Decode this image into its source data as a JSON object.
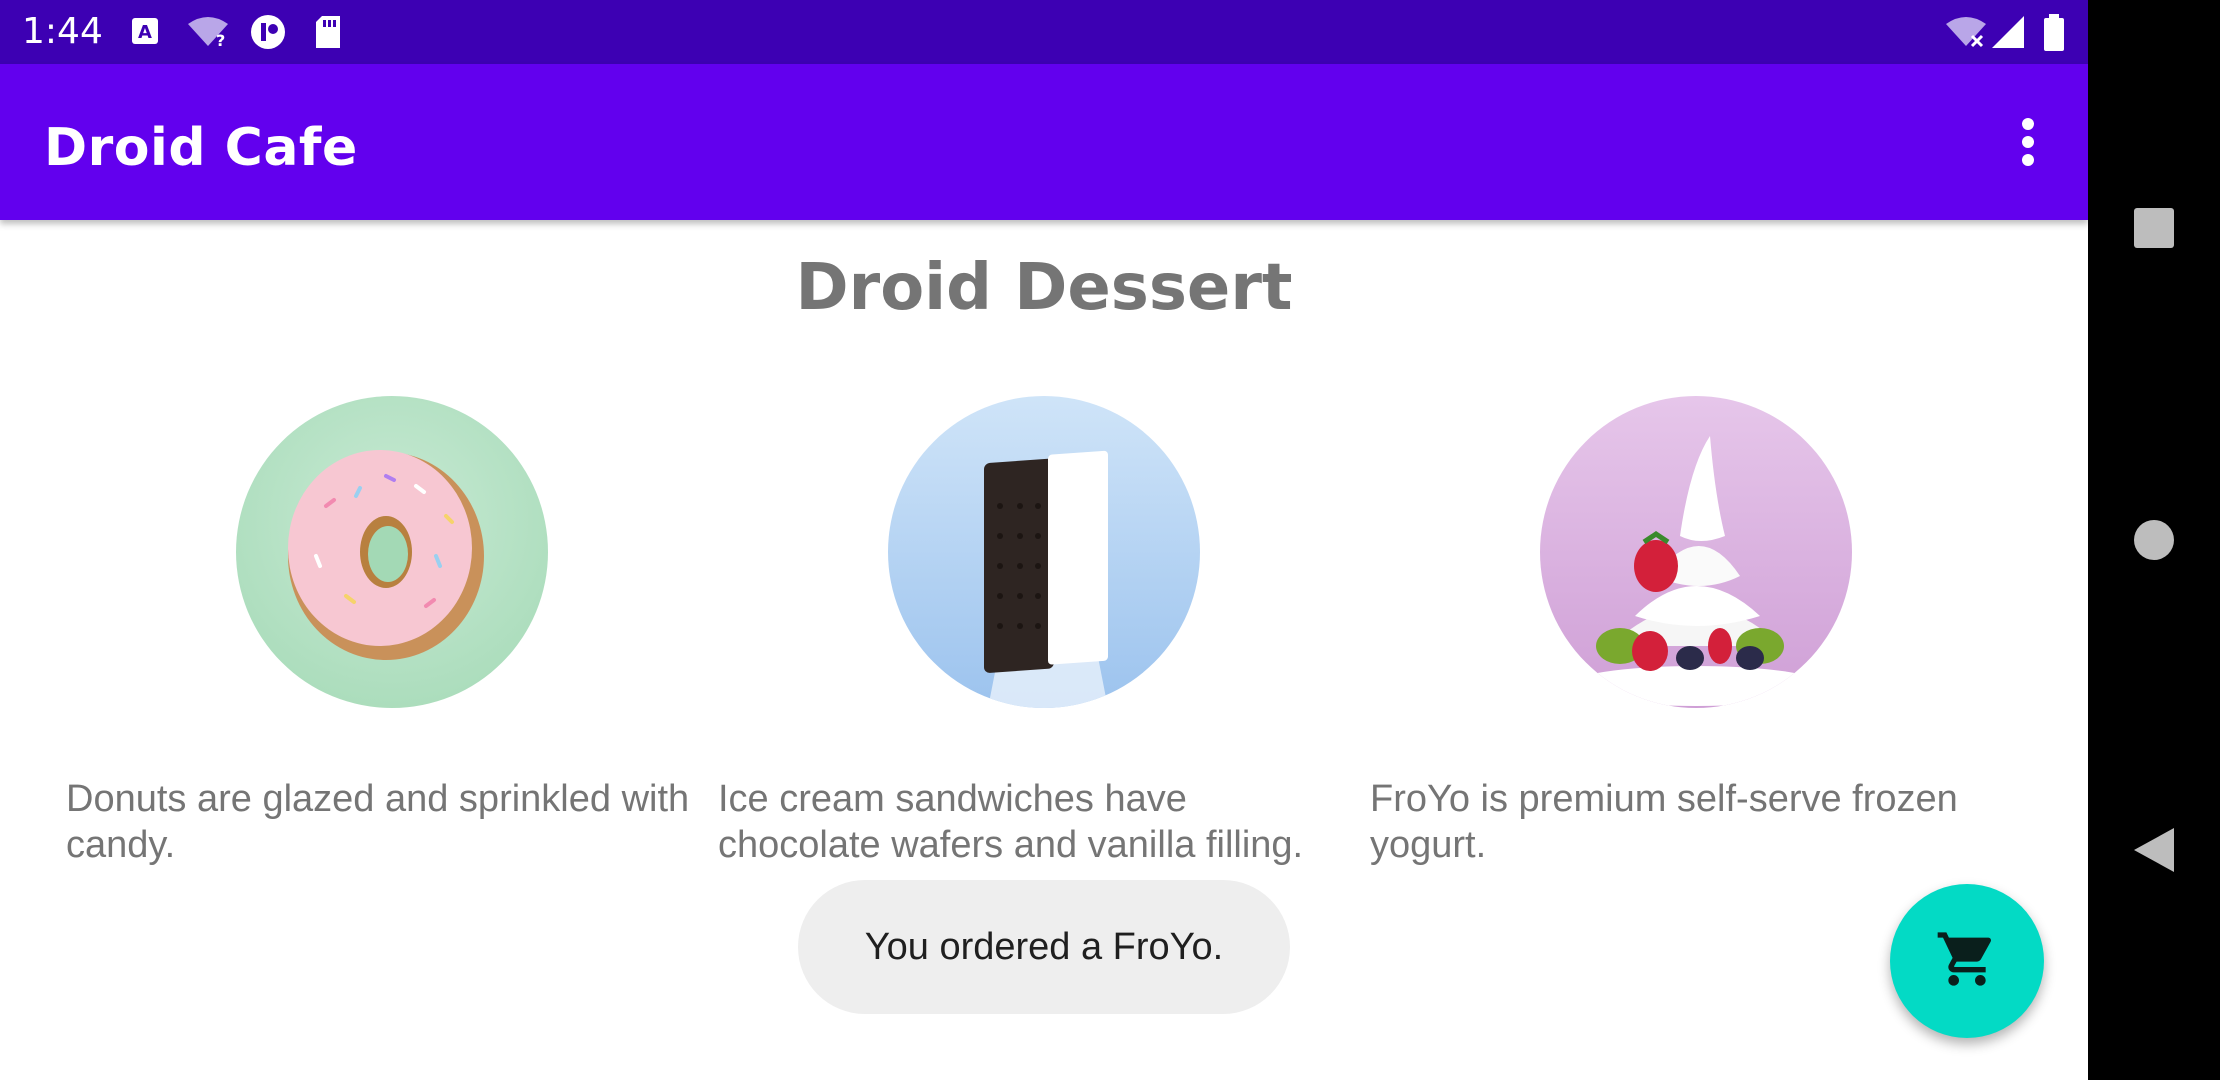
{
  "status_bar": {
    "time": "1:44",
    "icons_left": [
      "keyboard-a-icon",
      "wifi-question-icon",
      "app-circle-icon",
      "sd-card-icon"
    ],
    "icons_right": [
      "wifi-off-icon",
      "signal-icon",
      "battery-icon"
    ]
  },
  "app_bar": {
    "title": "Droid Cafe",
    "menu_icon": "overflow-menu-icon"
  },
  "main": {
    "heading": "Droid Dessert",
    "items": [
      {
        "image": "donut-image",
        "description": "Donuts are glazed and sprinkled with candy."
      },
      {
        "image": "ice-cream-sandwich-image",
        "description": "Ice cream sandwiches have chocolate wafers and vanilla filling."
      },
      {
        "image": "froyo-image",
        "description": "FroYo is premium self-serve frozen yogurt."
      }
    ]
  },
  "toast": {
    "message": "You ordered a FroYo."
  },
  "fab": {
    "icon": "shopping-cart-icon"
  },
  "nav": {
    "buttons": [
      "recents-icon",
      "home-icon",
      "back-icon"
    ]
  },
  "colors": {
    "status_bar": "#3d00b3",
    "app_bar": "#6200ee",
    "fab": "#03dac5",
    "text_gray": "#757575"
  }
}
